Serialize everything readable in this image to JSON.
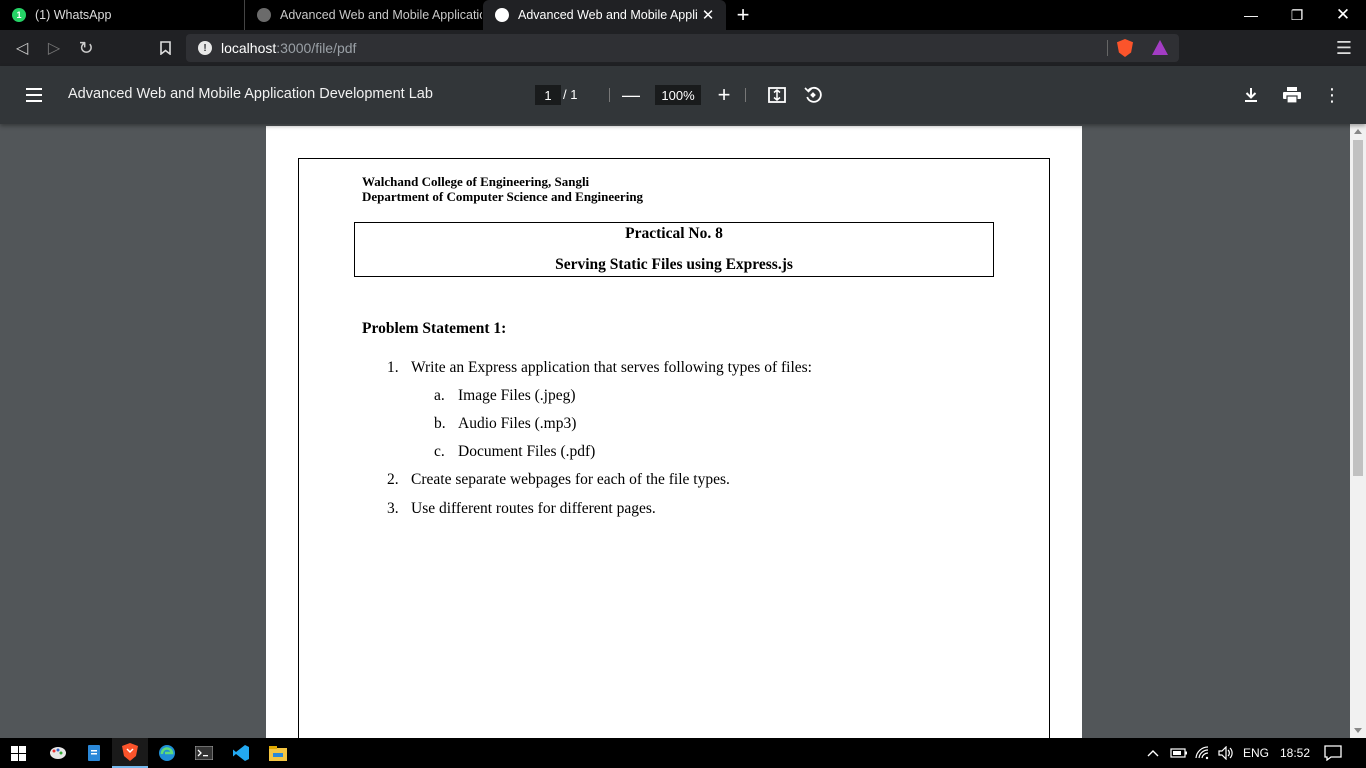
{
  "tabs": [
    {
      "title": "(1) WhatsApp",
      "badge": "1"
    },
    {
      "title": "Advanced Web and Mobile Applicatio"
    },
    {
      "title": "Advanced Web and Mobile Applic"
    }
  ],
  "address": {
    "host": "localhost",
    "path": ":3000/file/pdf"
  },
  "pdf_toolbar": {
    "title": "Advanced Web and Mobile Application Development Lab",
    "current_page": "1",
    "page_total": "/ 1",
    "zoom": "100%"
  },
  "document": {
    "college": "Walchand College of Engineering, Sangli",
    "department": "Department of Computer Science and Engineering",
    "practical_no": "Practical No. 8",
    "practical_title": "Serving Static Files using Express.js",
    "problem_heading": "Problem Statement 1:",
    "items": [
      {
        "num": "1.",
        "text": "Write an Express application that serves following types of files:"
      },
      {
        "num": "a.",
        "text": "Image Files (.jpeg)"
      },
      {
        "num": "b.",
        "text": "Audio Files (.mp3)"
      },
      {
        "num": "c.",
        "text": "Document Files (.pdf)"
      },
      {
        "num": "2.",
        "text": "Create separate webpages for each of the file types."
      },
      {
        "num": "3.",
        "text": "Use different routes for different pages."
      }
    ]
  },
  "taskbar": {
    "language": "ENG",
    "time": "18:52"
  },
  "colors": {
    "tab_strip": "#000000",
    "toolbar": "#323639",
    "viewer_bg": "#525659",
    "whatsapp": "#25d366",
    "brave": "#fb542b"
  }
}
